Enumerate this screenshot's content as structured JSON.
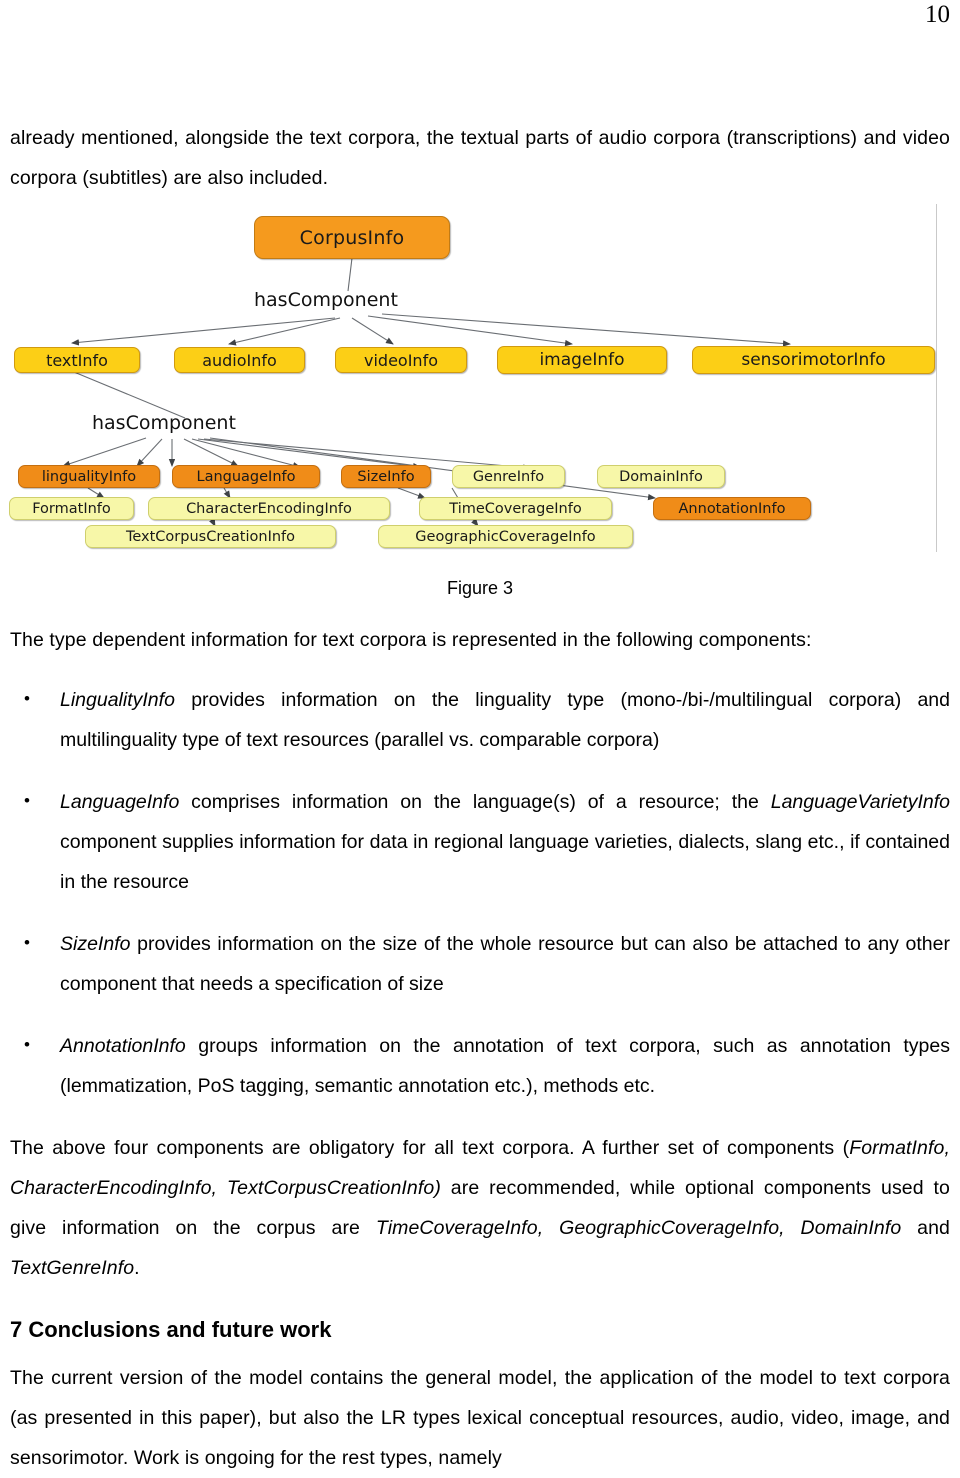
{
  "page": {
    "number": "10"
  },
  "intro": {
    "paragraph": "already mentioned, alongside the text corpora, the textual parts of audio corpora (transcriptions) and video corpora (subtitles) are also included."
  },
  "figure": {
    "caption": "Figure 3",
    "edge_labels": {
      "level1": "hasComponent",
      "level2": "hasComponent"
    },
    "nodes": {
      "root": "CorpusInfo",
      "level2": [
        "textInfo",
        "audioInfo",
        "videoInfo",
        "imageInfo",
        "sensorimotorInfo"
      ],
      "level3": [
        "lingualityInfo",
        "LanguageInfo",
        "SizeInfo",
        "GenreInfo",
        "DomainInfo"
      ],
      "level4": [
        "FormatInfo",
        "CharacterEncodingInfo",
        "TimeCoverageInfo",
        "AnnotationInfo"
      ],
      "level5": [
        "TextCorpusCreationInfo",
        "GeographicCoverageInfo"
      ]
    },
    "colors": {
      "root_fill": "#f59a1e",
      "level2_fill": "#fccf16",
      "orange_fill": "#f08c18",
      "pale_fill": "#f7f7a8",
      "edge_stroke": "#55585c"
    }
  },
  "body": {
    "lead_in": "The type dependent information for text corpora is represented in the following components:",
    "bullets": [
      {
        "term": "LingualityInfo",
        "rest": " provides information on the linguality type (mono-/bi-/multilingual corpora) and multilinguality type of text resources (parallel vs. comparable corpora)"
      },
      {
        "term": "LanguageInfo",
        "mid": " comprises information on the language(s) of a resource; the ",
        "term2": "LanguageVarietyInfo",
        "rest": " component supplies information for data in regional language varieties, dialects, slang etc., if contained in the resource"
      },
      {
        "term": "SizeInfo",
        "rest": " provides information on the size of the whole resource but can also be attached to any other component that needs a specification of size"
      },
      {
        "term": "AnnotationInfo",
        "rest": " groups information on the annotation of text corpora, such as annotation types (lemmatization, PoS tagging, semantic annotation etc.), methods etc."
      }
    ],
    "paragraph_components": {
      "p1": "The above four components are obligatory for all text corpora. A further set of components (",
      "i1": "FormatInfo, CharacterEncodingInfo, TextCorpusCreationInfo)",
      "p2": " are recommended, while optional components used to give information on the corpus are ",
      "i2": "TimeCoverageInfo, GeographicCoverageInfo, DomainInfo",
      "p3": " and ",
      "i3": "TextGenreInfo",
      "p4": "."
    },
    "section_heading": "7 Conclusions and future work",
    "conclusion": "The current version of the model contains the general model, the application of the model to text corpora (as presented in this paper), but also the LR types lexical conceptual resources, audio, video, image, and sensorimotor. Work is ongoing for the rest types, namely"
  }
}
